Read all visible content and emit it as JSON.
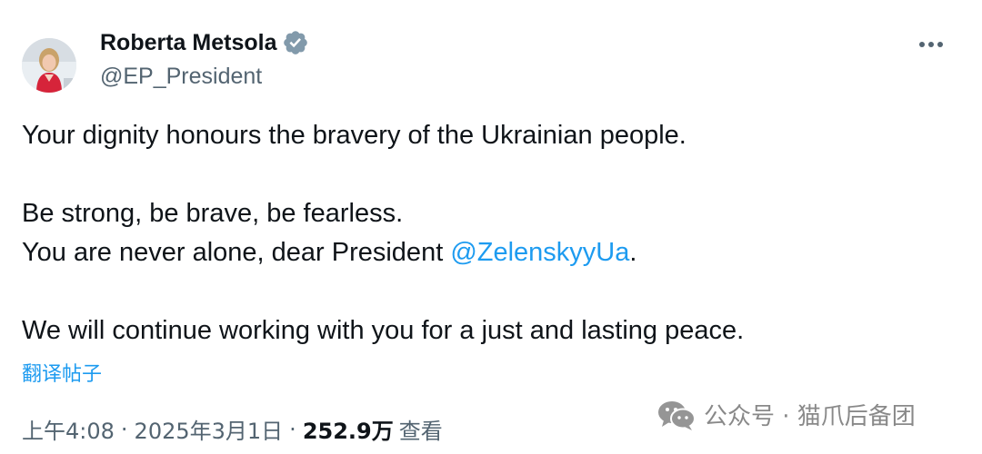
{
  "author": {
    "name": "Roberta Metsola",
    "handle": "@EP_President"
  },
  "icons": {
    "verified": "verified-badge-icon",
    "more": "more-options-icon",
    "watermark": "wechat-icon"
  },
  "colors": {
    "link": "#1d9bf0",
    "secondary_text": "#536471",
    "primary_text": "#0f1419"
  },
  "tweet": {
    "line1": "Your dignity honours the bravery of the Ukrainian people.",
    "line2": "Be strong, be brave, be fearless.",
    "line3_prefix": "You are never alone, dear President ",
    "mention": "@ZelenskyyUa",
    "line3_suffix": ".",
    "line4": "We will continue working with you for a just and lasting peace."
  },
  "translate_label": "翻译帖子",
  "meta": {
    "time": "上午4:08",
    "separator": "·",
    "date": "2025年3月1日",
    "views_count": "252.9万",
    "views_label": "查看"
  },
  "watermark": {
    "text": "公众号 · 猫爪后备团"
  }
}
